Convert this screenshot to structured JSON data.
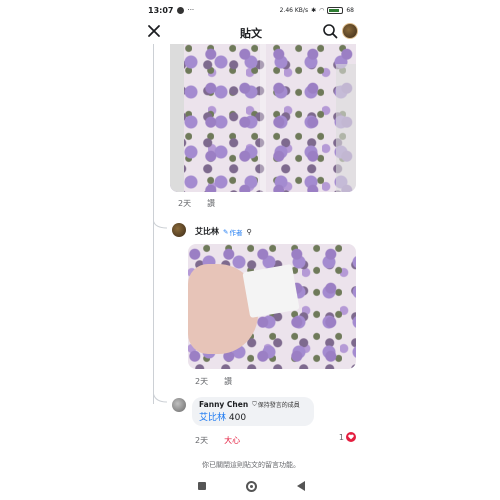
{
  "status_bar": {
    "time": "13:07",
    "dots": "···",
    "net_speed": "2.46 KB/s",
    "battery": "68"
  },
  "header": {
    "title": "貼文"
  },
  "post1": {
    "time": "2天",
    "like_label": "讚"
  },
  "comment_author": {
    "name": "艾比林",
    "badge": "作者",
    "time": "2天",
    "like_label": "讚"
  },
  "comment2": {
    "name": "Fanny Chen",
    "badge": "保持發言的成員",
    "mention": "艾比林",
    "text": " 400",
    "time": "2天",
    "like_label": "大心",
    "reaction_count": "1"
  },
  "notice": "你已關閉這則貼文的留言功能。",
  "colors": {
    "accent": "#1877f2",
    "love": "#e41e3f",
    "bubble": "#f0f2f5"
  }
}
